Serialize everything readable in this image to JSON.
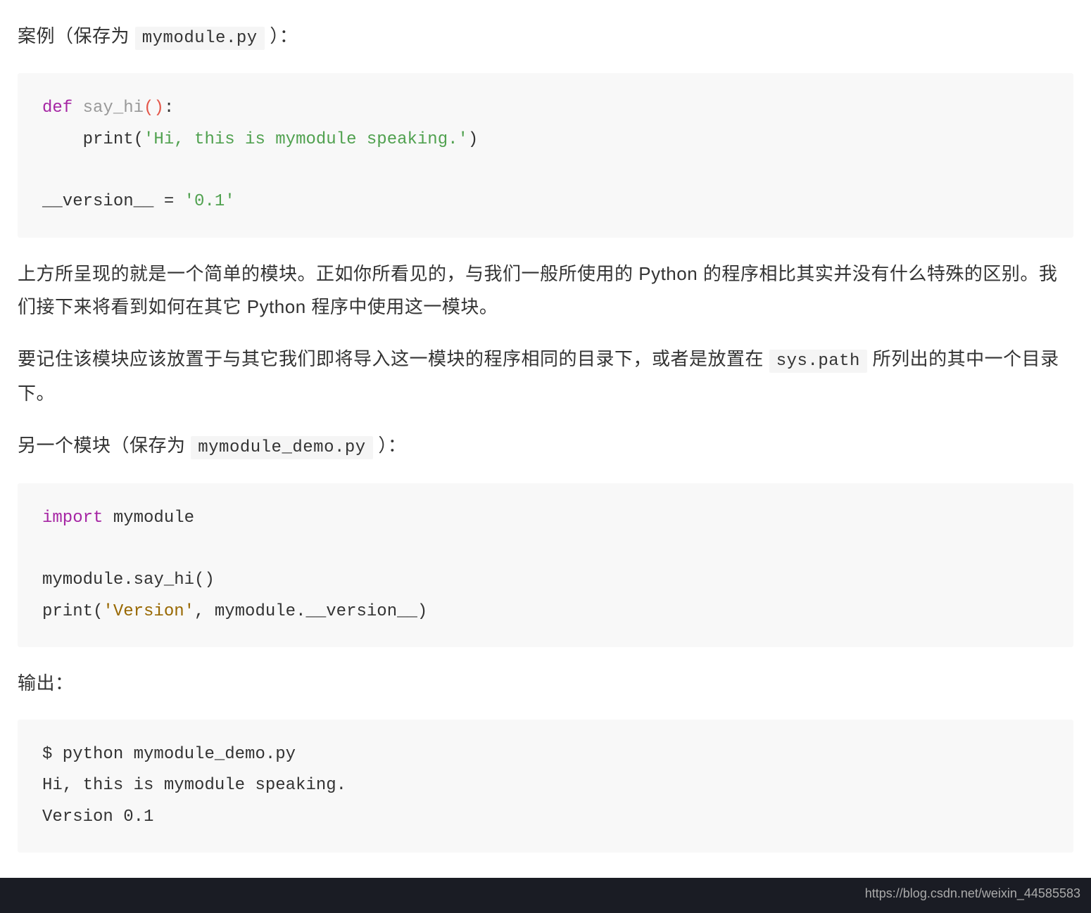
{
  "para1": {
    "prefix": "案例（保存为 ",
    "code": "mymodule.py",
    "suffix": " ）："
  },
  "codeblock1": {
    "line1_def": "def",
    "line1_fn": "say_hi",
    "line1_paren": "()",
    "line1_colon": ":",
    "line2_indent": "    print(",
    "line2_str": "'Hi, this is mymodule speaking.'",
    "line2_close": ")",
    "line4_var": "__version__ = ",
    "line4_str": "'0.1'"
  },
  "para2": "上方所呈现的就是一个简单的模块。正如你所看见的，与我们一般所使用的 Python 的程序相比其实并没有什么特殊的区别。我们接下来将看到如何在其它 Python 程序中使用这一模块。",
  "para3": {
    "prefix": "要记住该模块应该放置于与其它我们即将导入这一模块的程序相同的目录下，或者是放置在 ",
    "code": "sys.path",
    "suffix": " 所列出的其中一个目录下。"
  },
  "para4": {
    "prefix": "另一个模块（保存为 ",
    "code": "mymodule_demo.py",
    "suffix": " ）："
  },
  "codeblock2": {
    "line1_import": "import",
    "line1_mod": " mymodule",
    "line3": "mymodule.say_hi()",
    "line4_pre": "print(",
    "line4_str": "'Version'",
    "line4_post": ", mymodule.__version__)"
  },
  "para5": "输出：",
  "codeblock3": {
    "line1": "$ python mymodule_demo.py",
    "line2": "Hi, this is mymodule speaking.",
    "line3": "Version 0.1"
  },
  "watermark": "https://blog.csdn.net/weixin_44585583"
}
